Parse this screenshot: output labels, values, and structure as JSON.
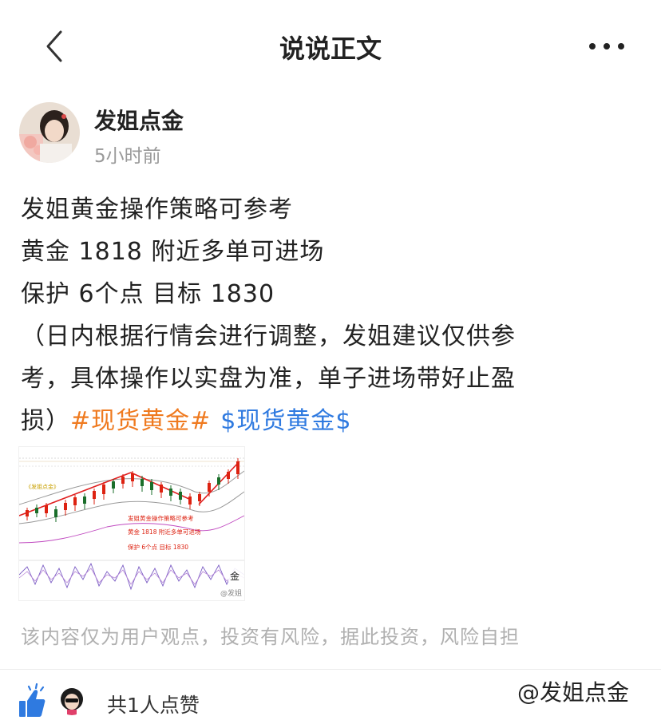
{
  "nav": {
    "title": "说说正文",
    "back_icon": "chevron-left-icon",
    "more_icon": "more-horizontal-icon"
  },
  "post": {
    "author": "发姐点金",
    "time": "5小时前",
    "lines": [
      "发姐黄金操作策略可参考",
      "黄金 1818 附近多单可进场",
      "保护 6个点 目标 1830",
      "（日内根据行情会进行调整，发姐建议仅供参",
      "考，具体操作以实盘为准，单子进场带好止盈",
      "损）"
    ],
    "topic_tag": "#现货黄金#",
    "stock_tag": "$现货黄金$",
    "image": {
      "label": "《发姐点金》",
      "overlay_lines": [
        "发姐黄金操作策略可参考",
        "黄金 1818 附近多单可进场",
        "保护 6个点 目标 1830"
      ],
      "corner_text": "金",
      "watermark": "@发姐"
    }
  },
  "disclaimer": "该内容仅为用户观点，投资有风险，据此投资，风险自担",
  "likes": {
    "text": "共1人点赞",
    "icon": "thumbs-up-icon"
  },
  "watermark": "@发姐点金",
  "colors": {
    "topic": "#ef7a1f",
    "stock": "#2f7ae0",
    "like": "#2f7ae0",
    "muted": "#9a9a9a"
  }
}
